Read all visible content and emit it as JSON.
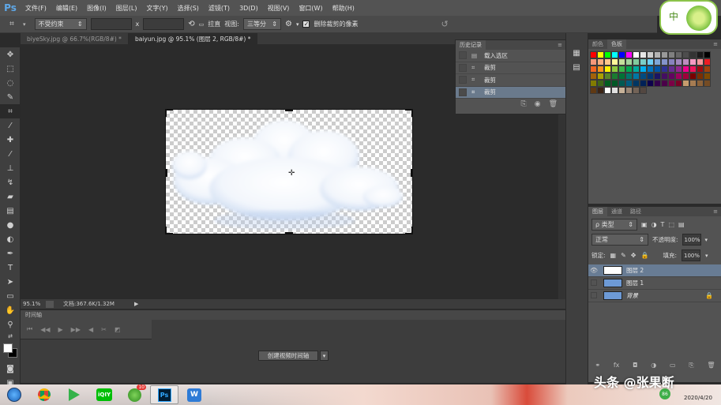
{
  "app": {
    "logo": "Ps"
  },
  "menu": [
    "文件(F)",
    "编辑(E)",
    "图像(I)",
    "图层(L)",
    "文字(Y)",
    "选择(S)",
    "滤镜(T)",
    "3D(D)",
    "视图(V)",
    "窗口(W)",
    "帮助(H)"
  ],
  "options": {
    "ratio_dropdown": "不受约束",
    "x_sep": "x",
    "straighten_label": "拉直",
    "view_label": "视图:",
    "view_dropdown": "三等分",
    "delete_cropped_label": "删除裁剪的像素",
    "delete_cropped_checked": true
  },
  "doc_tabs": [
    {
      "label": "biyeSky.jpg @ 66.7%(RGB/8#) *",
      "active": false
    },
    {
      "label": "baiyun.jpg @ 95.1% (图层 2, RGB/8#) *",
      "active": true
    }
  ],
  "status": {
    "zoom": "95.1%",
    "doc_info": "文档:367.6K/1.32M"
  },
  "timeline": {
    "title": "时间轴",
    "create_button": "创建视频时间轴"
  },
  "history": {
    "tab": "历史记录",
    "items": [
      {
        "label": "载入选区",
        "selected": false
      },
      {
        "label": "裁剪",
        "selected": false
      },
      {
        "label": "裁剪",
        "selected": false
      },
      {
        "label": "裁剪",
        "selected": true
      }
    ]
  },
  "swatches": {
    "tabs": [
      "颜色",
      "色板"
    ],
    "colors": [
      "#ff0000",
      "#ffff00",
      "#00ff00",
      "#00ffff",
      "#0000ff",
      "#ff00ff",
      "#ffffff",
      "#e6e6e6",
      "#cccccc",
      "#b3b3b3",
      "#999999",
      "#808080",
      "#666666",
      "#4d4d4d",
      "#333333",
      "#1a1a1a",
      "#000000",
      "#f7977a",
      "#f9ad81",
      "#fdc68a",
      "#fff79a",
      "#c4df9b",
      "#a3d39c",
      "#82ca9d",
      "#7bcdc8",
      "#6ecff6",
      "#7ea7d8",
      "#8493ca",
      "#8882be",
      "#a187be",
      "#bc8dbf",
      "#f49ac2",
      "#f6989d",
      "#ed1c24",
      "#f26522",
      "#f7941d",
      "#fff200",
      "#8dc73f",
      "#39b54a",
      "#00a651",
      "#00a99d",
      "#00aeef",
      "#0072bc",
      "#0054a6",
      "#2e3192",
      "#662d91",
      "#92278f",
      "#ec008c",
      "#ed145b",
      "#9e0b0f",
      "#a0410d",
      "#a36209",
      "#aba000",
      "#598527",
      "#1a7b30",
      "#007236",
      "#00746b",
      "#0076a3",
      "#004b80",
      "#003471",
      "#1b1464",
      "#440e62",
      "#630460",
      "#9e005d",
      "#9e0039",
      "#790000",
      "#7b2e00",
      "#7d4900",
      "#827b00",
      "#406618",
      "#005e20",
      "#005826",
      "#005952",
      "#005b7f",
      "#003663",
      "#002157",
      "#0d004c",
      "#32004b",
      "#4b0049",
      "#7b0046",
      "#7a0026",
      "#c69c6d",
      "#a67c52",
      "#8c6239",
      "#754c24",
      "#603913",
      "#3c2415",
      "#ffffff",
      "#e0e0e0",
      "#c7b299",
      "#998675",
      "#736357",
      "#534741"
    ]
  },
  "layers": {
    "tabs": [
      "图层",
      "通道",
      "路径"
    ],
    "filter_label": "ρ 类型",
    "blend_mode": "正常",
    "opacity_label": "不透明度:",
    "opacity_value": "100%",
    "lock_label": "锁定:",
    "fill_label": "填充:",
    "fill_value": "100%",
    "items": [
      {
        "name": "图层 2",
        "visible": true,
        "selected": true,
        "locked": false
      },
      {
        "name": "图层 1",
        "visible": false,
        "selected": false,
        "locked": false
      },
      {
        "name": "背景",
        "visible": false,
        "selected": false,
        "locked": true
      }
    ]
  },
  "taskbar": {
    "apps": [
      "start",
      "chrome",
      "video-player",
      "iqiyi",
      "360-browser",
      "photoshop",
      "app-w"
    ],
    "badge": "10",
    "tray_badge": "86",
    "date": "2020/4/20"
  },
  "watermark": "头条 @张果断",
  "ime": {
    "label": "中"
  }
}
